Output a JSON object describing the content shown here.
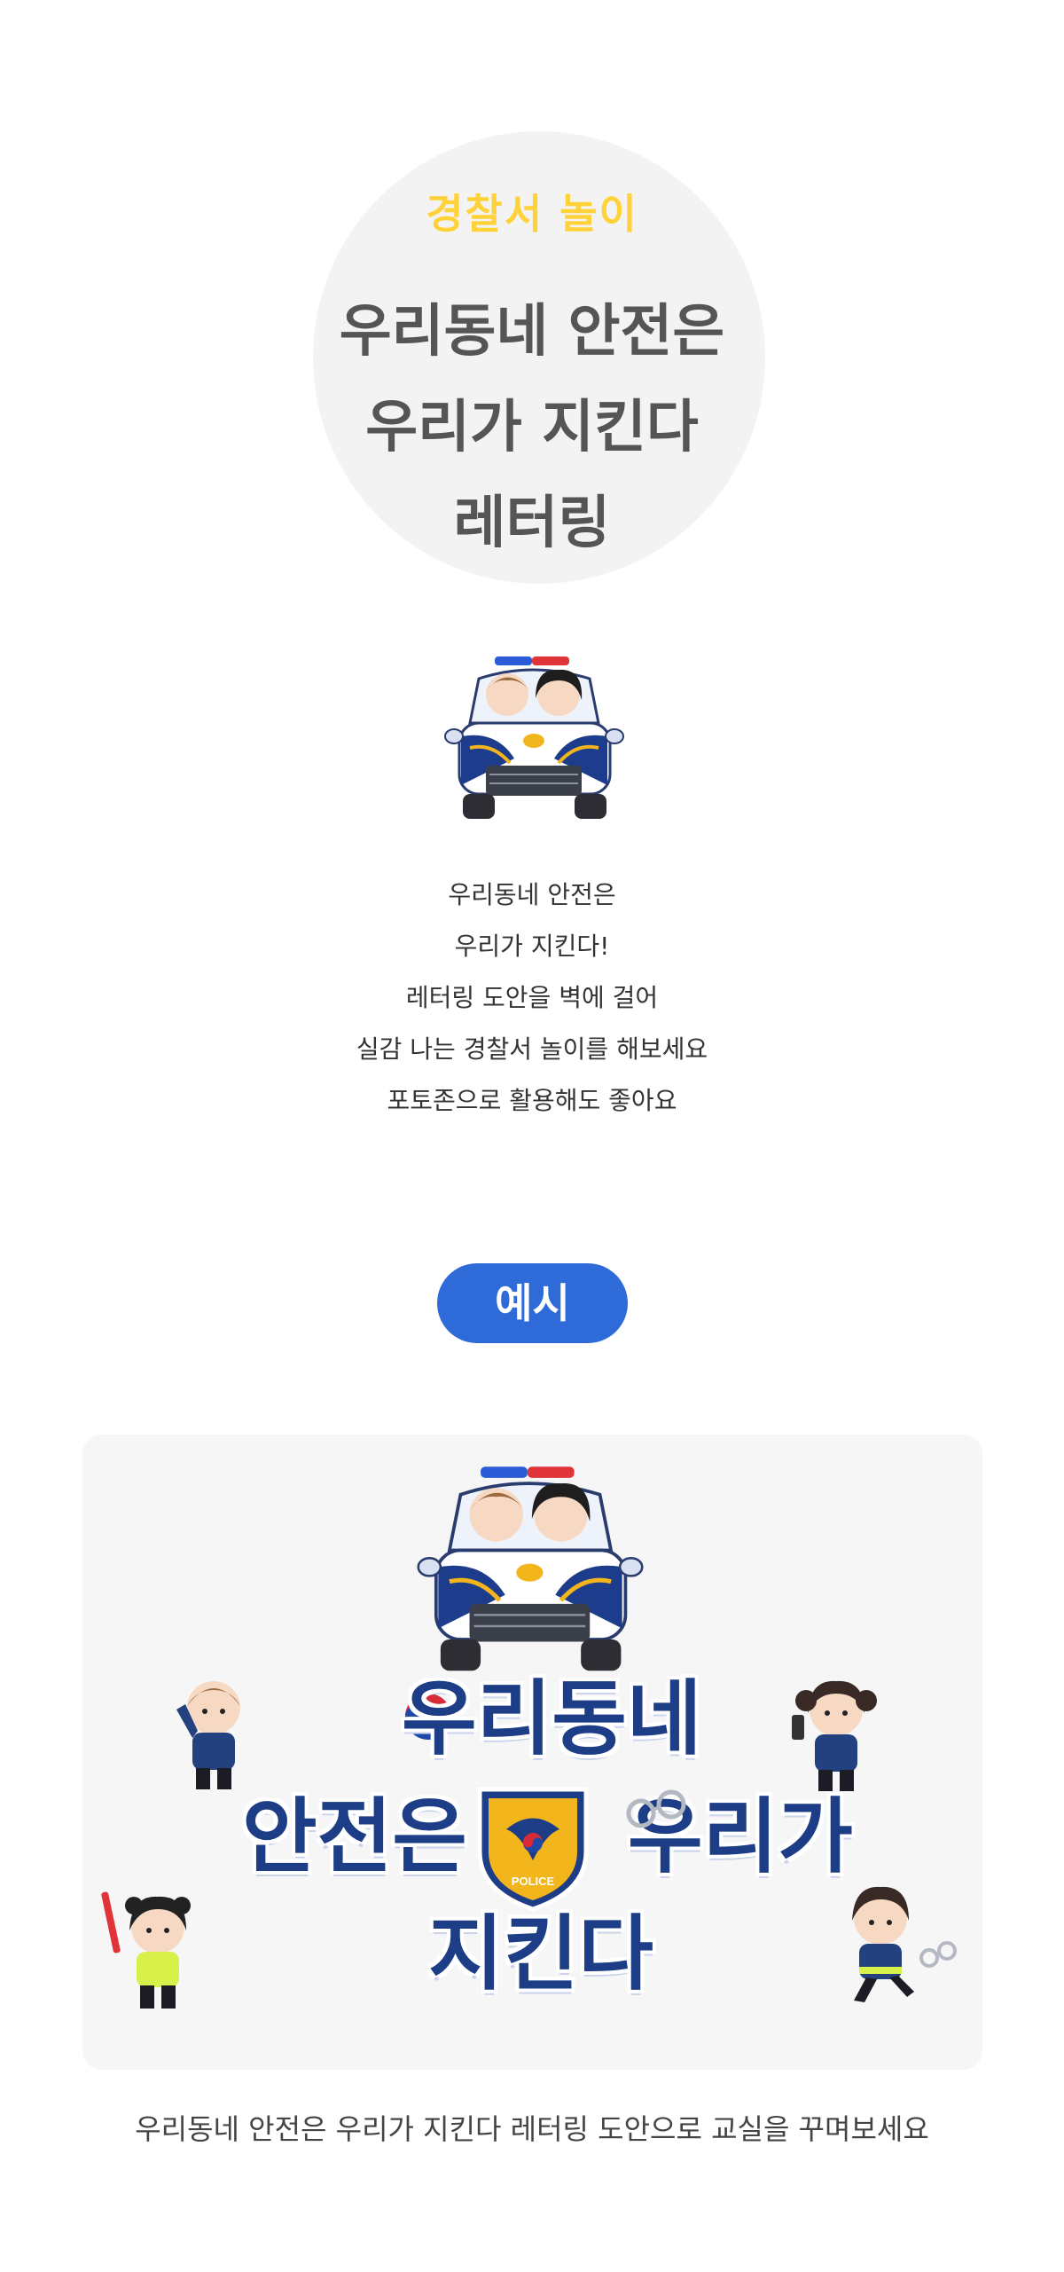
{
  "hero": {
    "subtitle": "경찰서 놀이",
    "title_lines": [
      "우리동네 안전은",
      "우리가 지킨다",
      "레터링"
    ]
  },
  "description": {
    "lines": [
      "우리동네 안전은",
      "우리가 지킨다!",
      "레터링 도안을 벽에 걸어",
      "실감 나는 경찰서 놀이를 해보세요",
      "포토존으로 활용해도 좋아요"
    ]
  },
  "example": {
    "label": "예시",
    "lettering": {
      "line1": "우리동네",
      "line2_left": "안전은",
      "line2_right": "우리가",
      "line3": "지킨다",
      "badge_text": "POLICE"
    }
  },
  "caption": "우리동네 안전은 우리가 지킨다 레터링 도안으로 교실을 꾸며보세요",
  "colors": {
    "accent_yellow": "#ffd23a",
    "accent_blue": "#2e6bd8",
    "lettering_navy": "#1d3d86",
    "badge_gold": "#f2b51c",
    "panel_bg": "#f6f6f6"
  }
}
